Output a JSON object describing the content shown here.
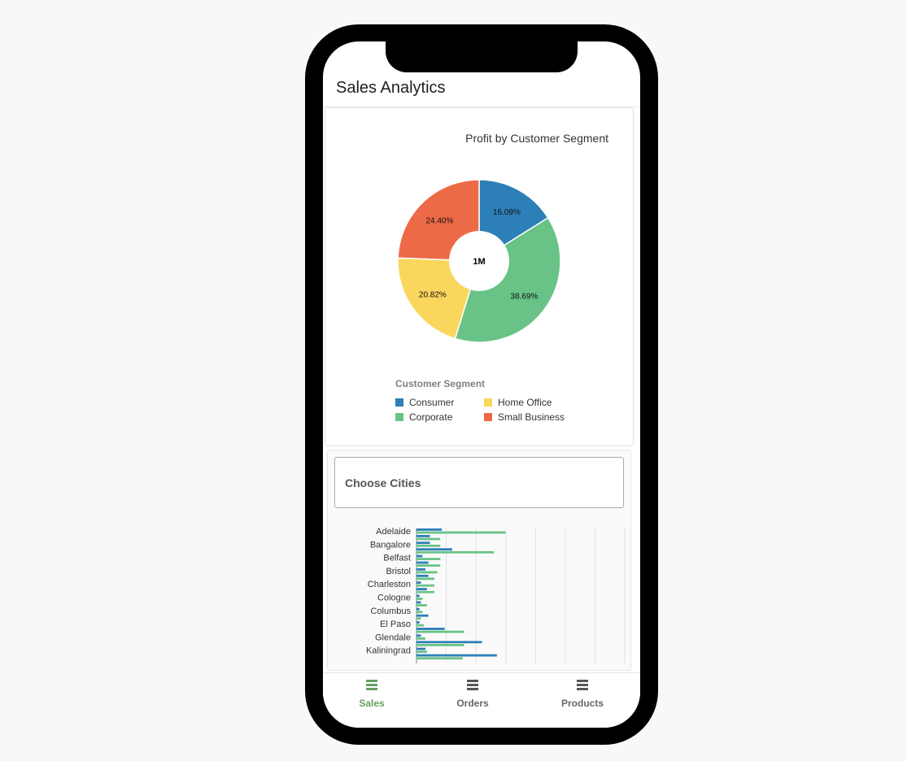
{
  "app": {
    "title": "Sales Analytics"
  },
  "colors": {
    "consumer": "#2d7fb8",
    "corporate": "#69c387",
    "home_office": "#fad65c",
    "small_business": "#ed6a47",
    "accent": "#66a061"
  },
  "pie_card": {
    "title": "Profit by Customer Segment",
    "center_label": "1M",
    "legend_title": "Customer Segment",
    "legend": [
      "Consumer",
      "Home Office",
      "Corporate",
      "Small Business"
    ]
  },
  "cities_card": {
    "select_placeholder": "Choose Cities"
  },
  "tabs": [
    {
      "label": "Sales",
      "icon": "table-icon",
      "active": true
    },
    {
      "label": "Orders",
      "icon": "table-icon",
      "active": false
    },
    {
      "label": "Products",
      "icon": "table-icon",
      "active": false
    }
  ],
  "chart_data": [
    {
      "type": "pie",
      "title": "Profit by Customer Segment",
      "categories": [
        "Consumer",
        "Corporate",
        "Home Office",
        "Small Business"
      ],
      "values": [
        16.09,
        38.69,
        20.82,
        24.4
      ],
      "labels": [
        "16.09%",
        "38.69%",
        "20.82%",
        "24.40%"
      ],
      "center_label": "1M",
      "legend_title": "Customer Segment",
      "legend_position": "bottom"
    },
    {
      "type": "bar",
      "orientation": "horizontal",
      "categories": [
        "Adelaide",
        "Bangalore",
        "Belfast",
        "Bristol",
        "Charleston",
        "Cologne",
        "Columbus",
        "El Paso",
        "Glendale",
        "Kaliningrad"
      ],
      "series": [
        {
          "values": [
            [
              8.5,
              30
            ],
            [
              4.5,
              8
            ],
            [
              2,
              8
            ],
            [
              3,
              7
            ],
            [
              1.5,
              6
            ],
            [
              1,
              2
            ],
            [
              1,
              2
            ],
            [
              1,
              2.5
            ],
            [
              1.5,
              3
            ],
            [
              3,
              3.5
            ]
          ]
        },
        {
          "values": [
            [
              4.5,
              8
            ],
            [
              12,
              26
            ],
            [
              4,
              8
            ],
            [
              4,
              6
            ],
            [
              3.5,
              6
            ],
            [
              1.5,
              3.5
            ],
            [
              4,
              1.5
            ],
            [
              9.5,
              16
            ],
            [
              22,
              16
            ],
            [
              27,
              15.5
            ]
          ]
        }
      ],
      "grid": true
    }
  ]
}
